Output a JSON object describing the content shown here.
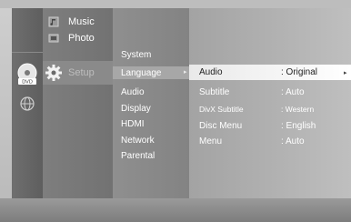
{
  "categories": [
    {
      "label": "Music",
      "icon": "music-icon"
    },
    {
      "label": "Photo",
      "icon": "photo-icon"
    },
    {
      "label": "Setup",
      "icon": "gear-icon"
    }
  ],
  "disc_badge": "DVD",
  "submenu": {
    "heading": "System",
    "items": [
      "Language",
      "Audio",
      "Display",
      "HDMI",
      "Network",
      "Parental"
    ],
    "selected_arrow": "▸"
  },
  "details": [
    {
      "key": "Audio",
      "value": ": Original"
    },
    {
      "key": "Subtitle",
      "value": ": Auto"
    },
    {
      "key": "DivX Subtitle",
      "value": ": Western"
    },
    {
      "key": "Disc Menu",
      "value": ": English"
    },
    {
      "key": "Menu",
      "value": ": Auto"
    }
  ],
  "detail_arrow": "▸",
  "colors": {
    "highlight": "#ffffff",
    "panel_dark": "#5e5e5e",
    "panel_mid": "#7e7e7e"
  }
}
